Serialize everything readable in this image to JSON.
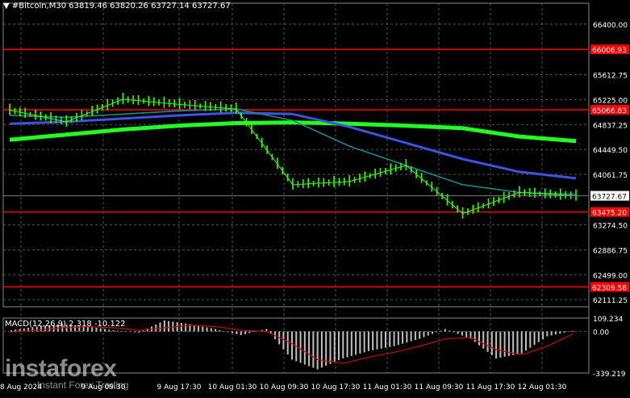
{
  "window": {
    "menu_arrow": "▼",
    "symbol": "#Bitcoin,M30",
    "ohlc": "63819.46 63820.26 63727.14 63727.67"
  },
  "price_axis": {
    "ticks": [
      "66400.00",
      "65612.75",
      "65225.00",
      "64837.25",
      "64449.50",
      "64061.75",
      "63274.50",
      "62886.75",
      "62499.00",
      "62111.25"
    ],
    "current_price": "63727.67",
    "levels": [
      "66006.93",
      "65066.83",
      "63475.20",
      "62309.58"
    ]
  },
  "time_axis": {
    "labels": [
      "8 Aug 2024",
      "9 Aug 09:30",
      "9 Aug 17:30",
      "10 Aug 01:30",
      "10 Aug 09:30",
      "10 Aug 17:30",
      "11 Aug 01:30",
      "11 Aug 09:30",
      "11 Aug 17:30",
      "12 Aug 01:30"
    ]
  },
  "macd": {
    "label": "MACD(12,26,9) 2.318 -10.122",
    "ticks": [
      "109.234",
      "0.00",
      "-339.219"
    ]
  },
  "watermark": {
    "brand": "instaforex",
    "tagline": "Instant Forex Trading"
  },
  "colors": {
    "background": "#000000",
    "candles": "#33ff00",
    "level_lines": "#ff0000",
    "ma_fast": "#1a8a8a",
    "ma_mid": "#3a55e0",
    "ma_slow": "#22ff22",
    "macd_hist": "#c0c0c0",
    "macd_signal": "#cc0000"
  },
  "chart_data": {
    "type": "line",
    "title": "#Bitcoin,M30",
    "ylim": [
      62000,
      66600
    ],
    "x": [
      "8 Aug 2024",
      "9 Aug 09:30",
      "9 Aug 17:30",
      "10 Aug 01:30",
      "10 Aug 09:30",
      "10 Aug 17:30",
      "11 Aug 01:30",
      "11 Aug 09:30",
      "11 Aug 17:30",
      "12 Aug 01:30",
      "12 Aug 05:30"
    ],
    "series": [
      {
        "values": [
          65060,
          64880,
          65230,
          65150,
          65080,
          63900,
          63950,
          64200,
          63450,
          63780,
          63727
        ]
      },
      {
        "values": [
          64980,
          64950,
          65000,
          65050,
          65080,
          64900,
          64500,
          64200,
          63900,
          63780,
          63750
        ]
      },
      {
        "values": [
          64850,
          64880,
          64930,
          64980,
          65020,
          65000,
          64800,
          64550,
          64300,
          64100,
          64000
        ]
      },
      {
        "values": [
          64600,
          64680,
          64760,
          64820,
          64860,
          64870,
          64850,
          64820,
          64780,
          64650,
          64580
        ]
      }
    ],
    "horizontal_levels": [
      66006.93,
      65066.83,
      63475.2,
      62309.58
    ],
    "macd": {
      "ylim": [
        -339.219,
        109.234
      ],
      "histogram": [
        10,
        40,
        60,
        40,
        10,
        -10,
        90,
        60,
        20,
        -30,
        20,
        -230,
        -310,
        -220,
        -160,
        -120,
        -60,
        20,
        -60,
        -220,
        -180,
        -40,
        5
      ],
      "signal": [
        -5,
        10,
        30,
        40,
        30,
        10,
        30,
        50,
        40,
        10,
        0,
        -100,
        -230,
        -260,
        -210,
        -170,
        -120,
        -60,
        -50,
        -150,
        -190,
        -120,
        -20
      ]
    }
  }
}
